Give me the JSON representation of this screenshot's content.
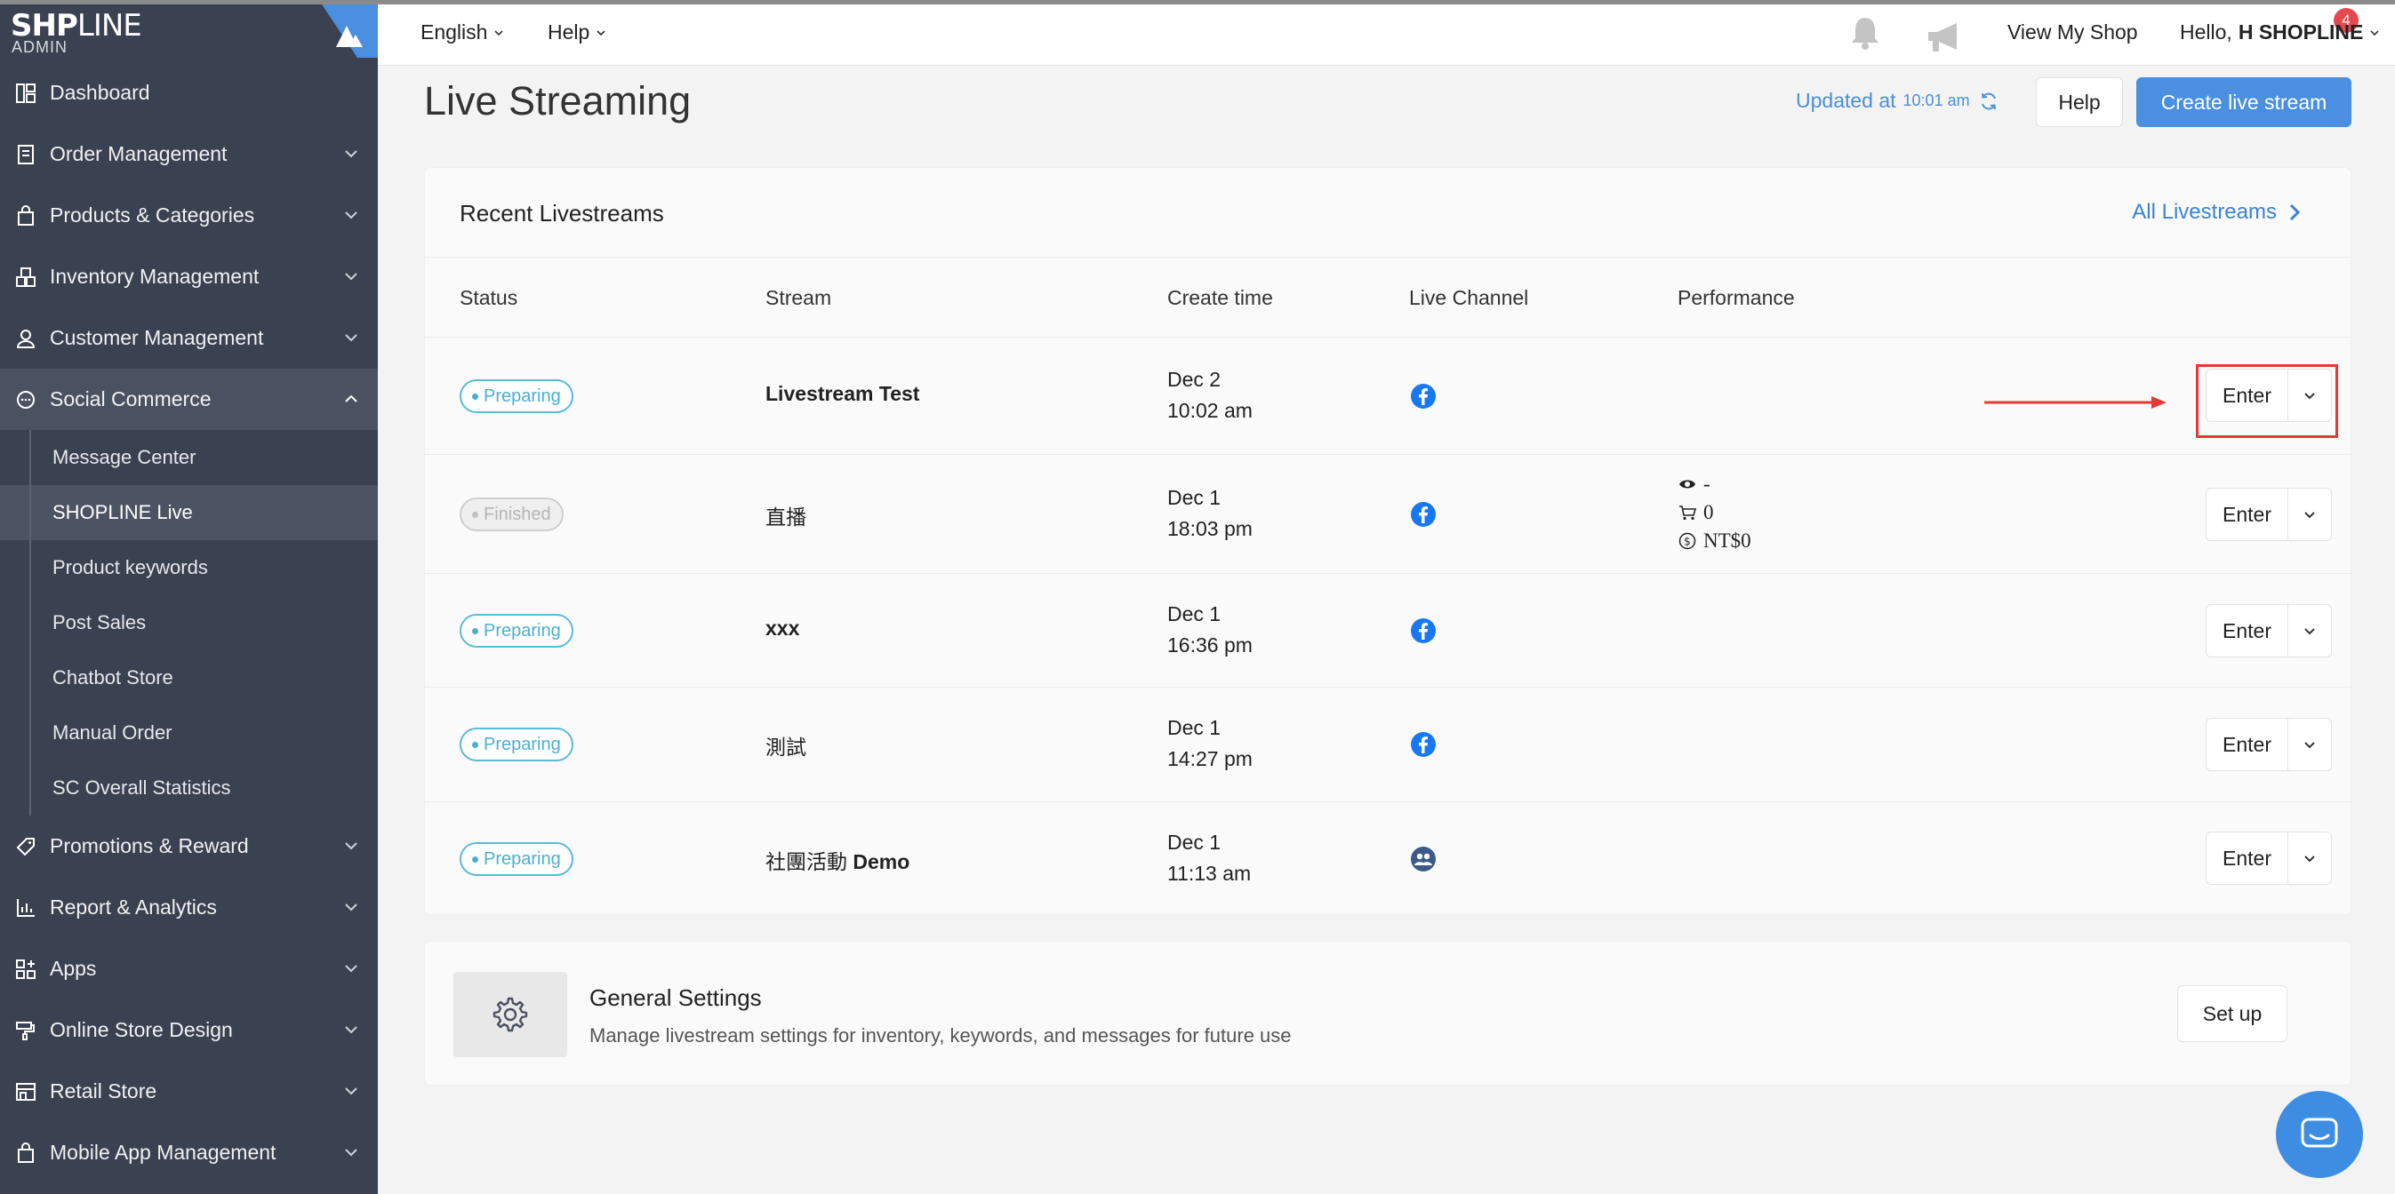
{
  "brand": {
    "logo_bold1": "SH",
    "logo_bold2": "P",
    "logo_light": "LINE",
    "admin": "ADMIN"
  },
  "sidebar": {
    "items": [
      {
        "label": "Dashboard",
        "icon": "dashboard-icon",
        "expandable": false
      },
      {
        "label": "Order Management",
        "icon": "order-icon",
        "expandable": true
      },
      {
        "label": "Products & Categories",
        "icon": "bag-icon",
        "expandable": true
      },
      {
        "label": "Inventory Management",
        "icon": "inventory-icon",
        "expandable": true
      },
      {
        "label": "Customer Management",
        "icon": "user-icon",
        "expandable": true
      },
      {
        "label": "Social Commerce",
        "icon": "chat-bubble-icon",
        "expandable": true,
        "open": true
      },
      {
        "label": "Promotions & Reward",
        "icon": "tag-icon",
        "expandable": true
      },
      {
        "label": "Report & Analytics",
        "icon": "chart-icon",
        "expandable": true
      },
      {
        "label": "Apps",
        "icon": "apps-icon",
        "expandable": true
      },
      {
        "label": "Online Store Design",
        "icon": "paint-roller-icon",
        "expandable": true
      },
      {
        "label": "Retail Store",
        "icon": "store-icon",
        "expandable": true
      },
      {
        "label": "Mobile App Management",
        "icon": "mobile-bag-icon",
        "expandable": true
      }
    ],
    "social_sub": [
      "Message Center",
      "SHOPLINE Live",
      "Product keywords",
      "Post Sales",
      "Chatbot Store",
      "Manual Order",
      "SC Overall Statistics"
    ]
  },
  "topbar": {
    "language": "English",
    "help": "Help",
    "notification_count": "4",
    "view_shop": "View My Shop",
    "hello": "Hello,",
    "user": "H SHOPLINE"
  },
  "page": {
    "title": "Live Streaming",
    "updated_label": "Updated at",
    "updated_time": "10:01 am",
    "help_button": "Help",
    "create_button": "Create live stream"
  },
  "recent": {
    "title": "Recent Livestreams",
    "all_link": "All Livestreams",
    "columns": [
      "Status",
      "Stream",
      "Create time",
      "Live Channel",
      "Performance"
    ],
    "rows": [
      {
        "status": "Preparing",
        "stream": "Livestream Test",
        "date": "Dec 2",
        "time": "10:02 am",
        "channel": "facebook-icon",
        "enter": "Enter"
      },
      {
        "status": "Finished",
        "stream": "直播",
        "date": "Dec 1",
        "time": "18:03 pm",
        "channel": "facebook-icon",
        "enter": "Enter",
        "perf_views": "-",
        "perf_orders": "0",
        "perf_sales": "NT$0"
      },
      {
        "status": "Preparing",
        "stream": "xxx",
        "date": "Dec 1",
        "time": "16:36 pm",
        "channel": "facebook-icon",
        "enter": "Enter"
      },
      {
        "status": "Preparing",
        "stream": "測試",
        "date": "Dec 1",
        "time": "14:27 pm",
        "channel": "facebook-icon",
        "enter": "Enter"
      },
      {
        "status": "Preparing",
        "stream_prefix": "社團活動",
        "stream": "Demo",
        "date": "Dec 1",
        "time": "11:13 am",
        "channel": "facebook-group-icon",
        "enter": "Enter"
      }
    ]
  },
  "settings": {
    "title": "General Settings",
    "description": "Manage livestream settings for inventory, keywords, and messages for future use",
    "button": "Set up"
  },
  "colors": {
    "primary": "#4a8fe0",
    "sidebar": "#3a4150",
    "facebook": "#1877f2",
    "annotation": "#e53935"
  }
}
